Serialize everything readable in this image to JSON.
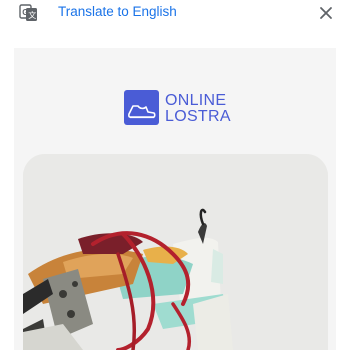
{
  "translate_bar": {
    "label": "Translate to English",
    "icons": {
      "translate": "translate-icon",
      "close": "close-icon"
    }
  },
  "logo": {
    "line1": "ONLINE",
    "line2": "LOSTRA",
    "icon": "shoe-logo-icon",
    "brand_color": "#4a5cd6"
  },
  "product": {
    "image": "sneaker-product-image"
  }
}
